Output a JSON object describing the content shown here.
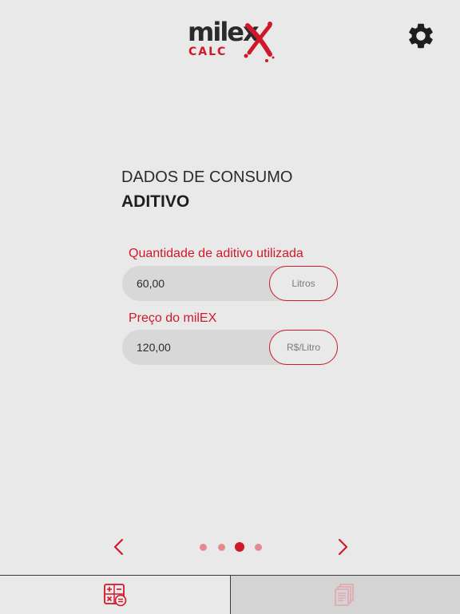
{
  "header": {
    "logo_word": "milex",
    "logo_subtitle": "CALC",
    "settings_icon": "gear-icon"
  },
  "section": {
    "title": "DADOS DE CONSUMO",
    "subtitle": "ADITIVO"
  },
  "fields": [
    {
      "label": "Quantidade de aditivo utilizada",
      "value": "60,00",
      "unit": "Litros"
    },
    {
      "label": "Preço do milEX",
      "value": "120,00",
      "unit": "R$/Litro"
    }
  ],
  "pager": {
    "prev_icon": "chevron-left-icon",
    "next_icon": "chevron-right-icon",
    "total_pages": 4,
    "current_page": 3
  },
  "tabs": [
    {
      "icon": "calculator-icon",
      "active": true
    },
    {
      "icon": "documents-icon",
      "active": false
    }
  ],
  "colors": {
    "accent": "#d0182a",
    "background": "#e9e9ea",
    "field_background": "#d8d8d9",
    "dot_inactive": "#e7898f"
  }
}
